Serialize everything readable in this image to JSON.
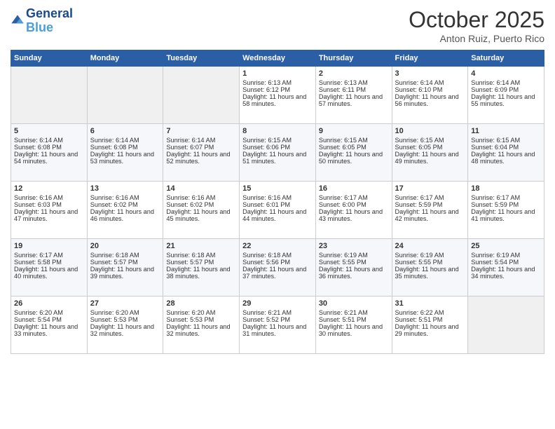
{
  "header": {
    "logo_line1": "General",
    "logo_line2": "Blue",
    "month": "October 2025",
    "location": "Anton Ruiz, Puerto Rico"
  },
  "days_of_week": [
    "Sunday",
    "Monday",
    "Tuesday",
    "Wednesday",
    "Thursday",
    "Friday",
    "Saturday"
  ],
  "weeks": [
    [
      {
        "day": "",
        "sunrise": "",
        "sunset": "",
        "daylight": ""
      },
      {
        "day": "",
        "sunrise": "",
        "sunset": "",
        "daylight": ""
      },
      {
        "day": "",
        "sunrise": "",
        "sunset": "",
        "daylight": ""
      },
      {
        "day": "1",
        "sunrise": "Sunrise: 6:13 AM",
        "sunset": "Sunset: 6:12 PM",
        "daylight": "Daylight: 11 hours and 58 minutes."
      },
      {
        "day": "2",
        "sunrise": "Sunrise: 6:13 AM",
        "sunset": "Sunset: 6:11 PM",
        "daylight": "Daylight: 11 hours and 57 minutes."
      },
      {
        "day": "3",
        "sunrise": "Sunrise: 6:14 AM",
        "sunset": "Sunset: 6:10 PM",
        "daylight": "Daylight: 11 hours and 56 minutes."
      },
      {
        "day": "4",
        "sunrise": "Sunrise: 6:14 AM",
        "sunset": "Sunset: 6:09 PM",
        "daylight": "Daylight: 11 hours and 55 minutes."
      }
    ],
    [
      {
        "day": "5",
        "sunrise": "Sunrise: 6:14 AM",
        "sunset": "Sunset: 6:08 PM",
        "daylight": "Daylight: 11 hours and 54 minutes."
      },
      {
        "day": "6",
        "sunrise": "Sunrise: 6:14 AM",
        "sunset": "Sunset: 6:08 PM",
        "daylight": "Daylight: 11 hours and 53 minutes."
      },
      {
        "day": "7",
        "sunrise": "Sunrise: 6:14 AM",
        "sunset": "Sunset: 6:07 PM",
        "daylight": "Daylight: 11 hours and 52 minutes."
      },
      {
        "day": "8",
        "sunrise": "Sunrise: 6:15 AM",
        "sunset": "Sunset: 6:06 PM",
        "daylight": "Daylight: 11 hours and 51 minutes."
      },
      {
        "day": "9",
        "sunrise": "Sunrise: 6:15 AM",
        "sunset": "Sunset: 6:05 PM",
        "daylight": "Daylight: 11 hours and 50 minutes."
      },
      {
        "day": "10",
        "sunrise": "Sunrise: 6:15 AM",
        "sunset": "Sunset: 6:05 PM",
        "daylight": "Daylight: 11 hours and 49 minutes."
      },
      {
        "day": "11",
        "sunrise": "Sunrise: 6:15 AM",
        "sunset": "Sunset: 6:04 PM",
        "daylight": "Daylight: 11 hours and 48 minutes."
      }
    ],
    [
      {
        "day": "12",
        "sunrise": "Sunrise: 6:16 AM",
        "sunset": "Sunset: 6:03 PM",
        "daylight": "Daylight: 11 hours and 47 minutes."
      },
      {
        "day": "13",
        "sunrise": "Sunrise: 6:16 AM",
        "sunset": "Sunset: 6:02 PM",
        "daylight": "Daylight: 11 hours and 46 minutes."
      },
      {
        "day": "14",
        "sunrise": "Sunrise: 6:16 AM",
        "sunset": "Sunset: 6:02 PM",
        "daylight": "Daylight: 11 hours and 45 minutes."
      },
      {
        "day": "15",
        "sunrise": "Sunrise: 6:16 AM",
        "sunset": "Sunset: 6:01 PM",
        "daylight": "Daylight: 11 hours and 44 minutes."
      },
      {
        "day": "16",
        "sunrise": "Sunrise: 6:17 AM",
        "sunset": "Sunset: 6:00 PM",
        "daylight": "Daylight: 11 hours and 43 minutes."
      },
      {
        "day": "17",
        "sunrise": "Sunrise: 6:17 AM",
        "sunset": "Sunset: 5:59 PM",
        "daylight": "Daylight: 11 hours and 42 minutes."
      },
      {
        "day": "18",
        "sunrise": "Sunrise: 6:17 AM",
        "sunset": "Sunset: 5:59 PM",
        "daylight": "Daylight: 11 hours and 41 minutes."
      }
    ],
    [
      {
        "day": "19",
        "sunrise": "Sunrise: 6:17 AM",
        "sunset": "Sunset: 5:58 PM",
        "daylight": "Daylight: 11 hours and 40 minutes."
      },
      {
        "day": "20",
        "sunrise": "Sunrise: 6:18 AM",
        "sunset": "Sunset: 5:57 PM",
        "daylight": "Daylight: 11 hours and 39 minutes."
      },
      {
        "day": "21",
        "sunrise": "Sunrise: 6:18 AM",
        "sunset": "Sunset: 5:57 PM",
        "daylight": "Daylight: 11 hours and 38 minutes."
      },
      {
        "day": "22",
        "sunrise": "Sunrise: 6:18 AM",
        "sunset": "Sunset: 5:56 PM",
        "daylight": "Daylight: 11 hours and 37 minutes."
      },
      {
        "day": "23",
        "sunrise": "Sunrise: 6:19 AM",
        "sunset": "Sunset: 5:55 PM",
        "daylight": "Daylight: 11 hours and 36 minutes."
      },
      {
        "day": "24",
        "sunrise": "Sunrise: 6:19 AM",
        "sunset": "Sunset: 5:55 PM",
        "daylight": "Daylight: 11 hours and 35 minutes."
      },
      {
        "day": "25",
        "sunrise": "Sunrise: 6:19 AM",
        "sunset": "Sunset: 5:54 PM",
        "daylight": "Daylight: 11 hours and 34 minutes."
      }
    ],
    [
      {
        "day": "26",
        "sunrise": "Sunrise: 6:20 AM",
        "sunset": "Sunset: 5:54 PM",
        "daylight": "Daylight: 11 hours and 33 minutes."
      },
      {
        "day": "27",
        "sunrise": "Sunrise: 6:20 AM",
        "sunset": "Sunset: 5:53 PM",
        "daylight": "Daylight: 11 hours and 32 minutes."
      },
      {
        "day": "28",
        "sunrise": "Sunrise: 6:20 AM",
        "sunset": "Sunset: 5:53 PM",
        "daylight": "Daylight: 11 hours and 32 minutes."
      },
      {
        "day": "29",
        "sunrise": "Sunrise: 6:21 AM",
        "sunset": "Sunset: 5:52 PM",
        "daylight": "Daylight: 11 hours and 31 minutes."
      },
      {
        "day": "30",
        "sunrise": "Sunrise: 6:21 AM",
        "sunset": "Sunset: 5:51 PM",
        "daylight": "Daylight: 11 hours and 30 minutes."
      },
      {
        "day": "31",
        "sunrise": "Sunrise: 6:22 AM",
        "sunset": "Sunset: 5:51 PM",
        "daylight": "Daylight: 11 hours and 29 minutes."
      },
      {
        "day": "",
        "sunrise": "",
        "sunset": "",
        "daylight": ""
      }
    ]
  ]
}
